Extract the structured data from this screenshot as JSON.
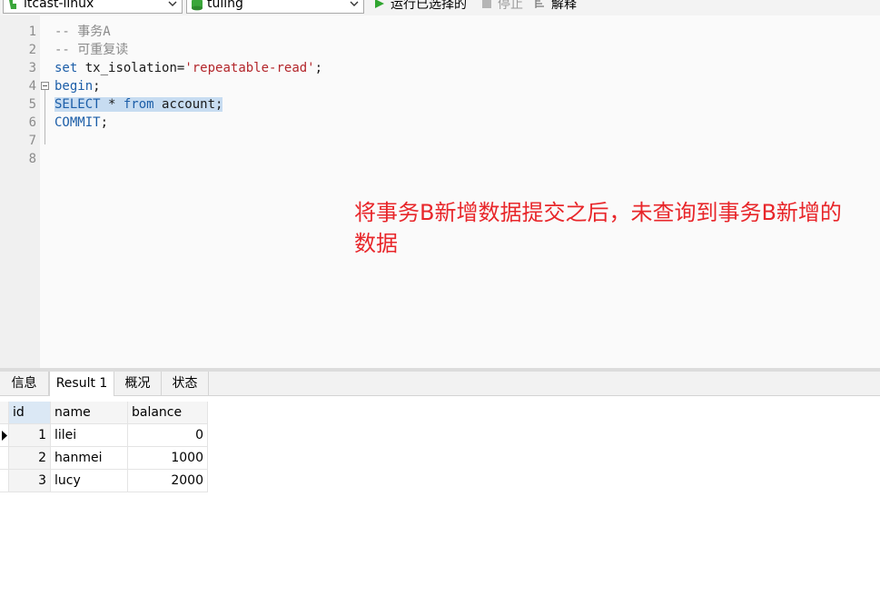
{
  "toolbar": {
    "connection": "itcast-linux",
    "database": "tuling",
    "run_selected": "运行已选择的",
    "stop": "停止",
    "explain": "解释"
  },
  "editor": {
    "line_numbers": [
      "1",
      "2",
      "3",
      "4",
      "5",
      "6",
      "7",
      "8"
    ],
    "lines": {
      "l1": "-- 事务A",
      "l2": "-- 可重复读",
      "l3_kw": "set",
      "l3_mid": " tx_isolation=",
      "l3_str": "'repeatable-read'",
      "l3_end": ";",
      "l4_kw": "begin",
      "l4_end": ";",
      "l5_kw1": "SELECT",
      "l5_mid": " * ",
      "l5_kw2": "from",
      "l5_end": " account;",
      "l6_kw": "COMMIT",
      "l6_end": ";"
    },
    "annotation": "将事务B新增数据提交之后，未查询到事务B新增的数据"
  },
  "result_tabs": [
    "信息",
    "Result 1",
    "概况",
    "状态"
  ],
  "grid": {
    "columns": [
      "id",
      "name",
      "balance"
    ],
    "rows": [
      {
        "id": "1",
        "name": "lilei",
        "balance": "0"
      },
      {
        "id": "2",
        "name": "hanmei",
        "balance": "1000"
      },
      {
        "id": "3",
        "name": "lucy",
        "balance": "2000"
      }
    ]
  },
  "colors": {
    "annotation": "#e8262a",
    "keyword": "#1c5ea8",
    "string": "#b3262b",
    "selection": "#c7dcf1"
  }
}
